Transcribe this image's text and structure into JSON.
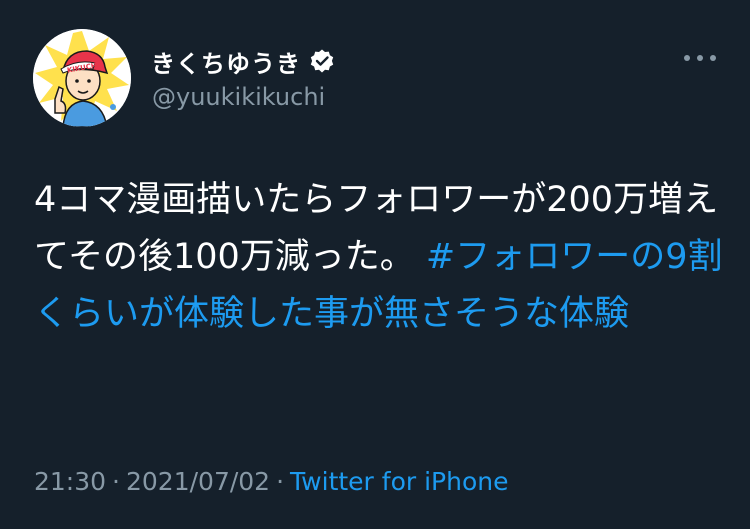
{
  "user": {
    "display_name": "きくちゆうき",
    "handle": "@yuukikikuchi",
    "verified": true,
    "avatar_icon": "avatar-illustration",
    "cap_text": "KIKUCHI"
  },
  "tweet": {
    "text": "4コマ漫画描いたらフォロワーが200万増えてその後100万減った。 ",
    "hashtag": "#フォロワーの9割くらいが体験した事が無さそうな体験"
  },
  "meta": {
    "time": "21:30",
    "date": "2021/07/02",
    "separator": "·",
    "source": "Twitter for iPhone"
  },
  "colors": {
    "background": "#15202b",
    "text": "#ffffff",
    "secondary": "#8899a6",
    "accent": "#1d9bf0"
  },
  "icons": {
    "more": "more-icon",
    "verified": "verified-badge-icon"
  }
}
